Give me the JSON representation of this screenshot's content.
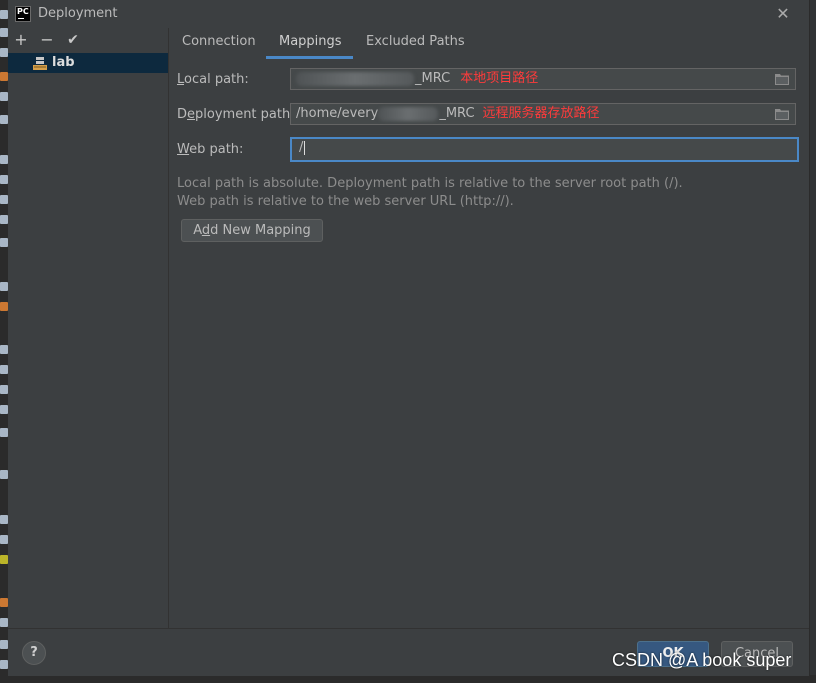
{
  "window": {
    "title": "Deployment"
  },
  "toolbar": {
    "add": "+",
    "remove": "−",
    "apply": "✔"
  },
  "tree": {
    "server": "lab"
  },
  "tabs": [
    "Connection",
    "Mappings",
    "Excluded Paths"
  ],
  "mapping": {
    "local_label_underline": "L",
    "local_label_rest": "ocal path:",
    "local_value": "_MRC",
    "local_annotation": "本地项目路径",
    "deploy_label_pre": "D",
    "deploy_label_underline": "e",
    "deploy_label_rest": "ployment path:",
    "deploy_value_prefix": "/home/every",
    "deploy_value_suffix": "_MRC",
    "deploy_annotation": "远程服务器存放路径",
    "web_label_underline": "W",
    "web_label_rest": "eb path:",
    "web_value": "/"
  },
  "hints": [
    "Local path is absolute. Deployment path is relative to the server root path (/).",
    "Web path is relative to the web server URL (http://)."
  ],
  "add_mapping": {
    "pre": "A",
    "underline": "d",
    "rest": "d New Mapping"
  },
  "footer": {
    "help": "?",
    "ok": "OK",
    "cancel": "Cancel"
  },
  "watermark": "CSDN @A book super",
  "colors": {
    "accent": "#4a88c7",
    "annotation": "#ff3b3b",
    "selection": "#0d293e"
  }
}
